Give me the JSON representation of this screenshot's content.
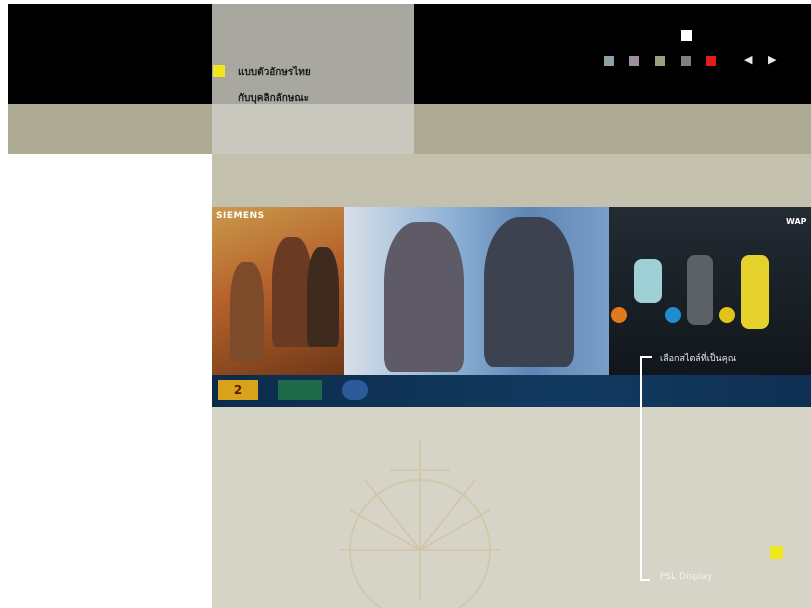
{
  "menu": {
    "line1": "แบบตัวอักษรไทย",
    "line2": "กับบุคลิกลักษณะ"
  },
  "nav": {
    "squares": [
      {
        "name": "blue-gray",
        "color": "#8ea0a6"
      },
      {
        "name": "mauve",
        "color": "#a08ea0"
      },
      {
        "name": "olive",
        "color": "#9aa07e"
      },
      {
        "name": "gray",
        "color": "#808080"
      },
      {
        "name": "red",
        "color": "#e31c1c"
      }
    ],
    "prev": "◀",
    "next": "▶"
  },
  "banner": {
    "brand": "SIEMENS",
    "brand_right": "WAP",
    "caption": "เลือกสไตล์ที่เป็นคุณ",
    "logos": [
      "2",
      "",
      ""
    ]
  },
  "footer_label": "PSL Display",
  "colors": {
    "accent_yellow": "#f0e81a",
    "panel": "#d6d4c6",
    "olive": "#adab94"
  }
}
